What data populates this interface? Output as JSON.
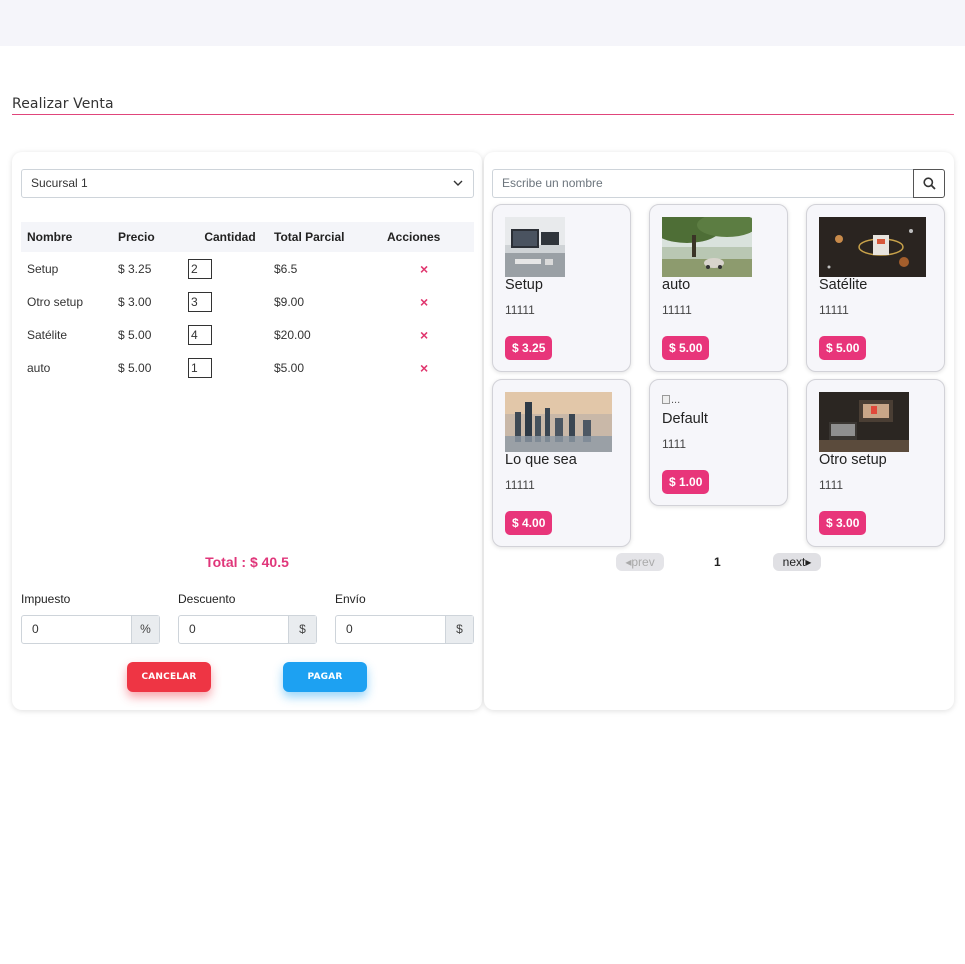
{
  "page": {
    "title": "Realizar Venta"
  },
  "sale": {
    "branch": "Sucursal 1",
    "columns": {
      "name": "Nombre",
      "price": "Precio",
      "quantity": "Cantidad",
      "subtotal": "Total Parcial",
      "actions": "Acciones"
    },
    "items": [
      {
        "name": "Setup",
        "price": "$ 3.25",
        "quantity": "2",
        "subtotal": "$6.5"
      },
      {
        "name": "Otro setup",
        "price": "$ 3.00",
        "quantity": "3",
        "subtotal": "$9.00"
      },
      {
        "name": "Satélite",
        "price": "$ 5.00",
        "quantity": "4",
        "subtotal": "$20.00"
      },
      {
        "name": "auto",
        "price": "$ 5.00",
        "quantity": "1",
        "subtotal": "$5.00"
      }
    ],
    "remove_glyph": "×",
    "total": "Total : $ 40.5",
    "tax": {
      "label": "Impuesto",
      "value": "0",
      "unit": "%"
    },
    "discount": {
      "label": "Descuento",
      "value": "0",
      "unit": "$"
    },
    "shipping": {
      "label": "Envío",
      "value": "0",
      "unit": "$"
    },
    "cancel_label": "CANCELAR",
    "pay_label": "PAGAR"
  },
  "catalog": {
    "search_placeholder": "Escribe un nombre",
    "products": [
      {
        "name": "Setup",
        "code": "11111",
        "price": "$ 3.25",
        "image": "desk-setup-photo"
      },
      {
        "name": "auto",
        "code": "11111",
        "price": "$ 5.00",
        "image": "car-under-tree-photo"
      },
      {
        "name": "Satélite",
        "code": "11111",
        "price": "$ 5.00",
        "image": "satellite-illustration"
      },
      {
        "name": "Lo que sea",
        "code": "11111",
        "price": "$ 4.00",
        "image": "city-skyline-photo"
      },
      {
        "name": "Default",
        "code": "1111",
        "price": "$ 1.00",
        "image": "broken-image",
        "image_alt": "..."
      },
      {
        "name": "Otro setup",
        "code": "1111",
        "price": "$ 3.00",
        "image": "dark-desk-photo"
      }
    ],
    "pagination": {
      "prev": "prev",
      "page": "1",
      "next": "next"
    }
  },
  "colors": {
    "accent": "#e8357a",
    "cancel": "#ee3544",
    "pay": "#1da1f2"
  }
}
